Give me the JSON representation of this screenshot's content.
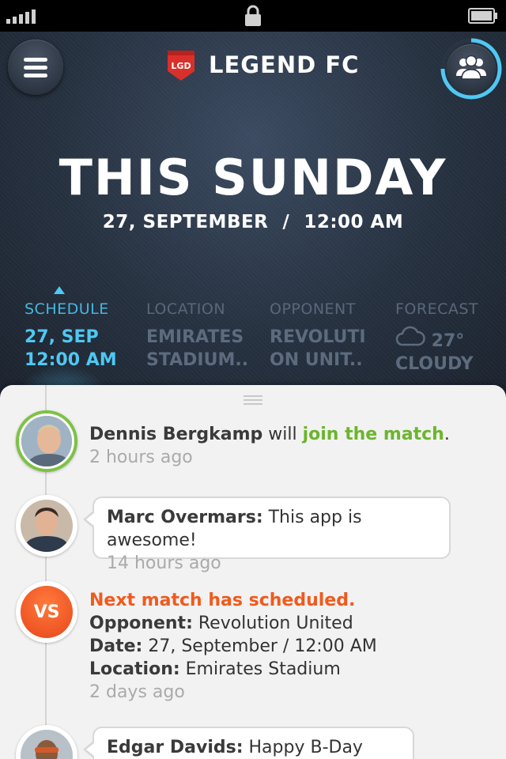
{
  "status_bar": {
    "signal_icon": "signal-bars-icon",
    "lock_icon": "lock-icon",
    "battery_icon": "battery-icon"
  },
  "header": {
    "menu_icon": "hamburger-menu-icon",
    "logo_text": "LGD",
    "team_name": "LEGEND FC",
    "people_icon": "people-icon",
    "day_title": "THIS SUNDAY",
    "date": "27, SEPTEMBER",
    "separator": "/",
    "time": "12:00 AM"
  },
  "tabs": [
    {
      "label": "SCHEDULE",
      "line1": "27, SEP",
      "line2": "12:00 AM",
      "active": true
    },
    {
      "label": "LOCATION",
      "line1": "EMIRATES",
      "line2": "STADIUM.."
    },
    {
      "label": "OPPONENT",
      "line1": "REVOLUTI",
      "line2": "ON UNIT.."
    },
    {
      "label": "FORECAST",
      "line1": "27°",
      "line2": "CLOUDY",
      "icon": "cloud-icon"
    }
  ],
  "feed": [
    {
      "name": "Dennis Bergkamp",
      "mid": " will ",
      "action": "join the match",
      "end": ".",
      "time": "2 hours ago"
    },
    {
      "name": "Marc Overmars:",
      "message": " This app is awesome!",
      "time": "14 hours ago"
    },
    {
      "badge": "VS",
      "headline": "Next match has scheduled.",
      "opponent_label": "Opponent:",
      "opponent": " Revolution United",
      "date_label": "Date:",
      "date": " 27, September / 12:00 AM",
      "location_label": "Location:",
      "location": " Emirates Stadium",
      "time": "2 days ago"
    },
    {
      "name": "Edgar Davids:",
      "message": " Happy B-Day Stam!"
    }
  ],
  "colors": {
    "accent_blue": "#4fc8f2",
    "join_green": "#6cb52d",
    "vs_orange": "#f05a1e",
    "header_bg": "#25303f"
  }
}
